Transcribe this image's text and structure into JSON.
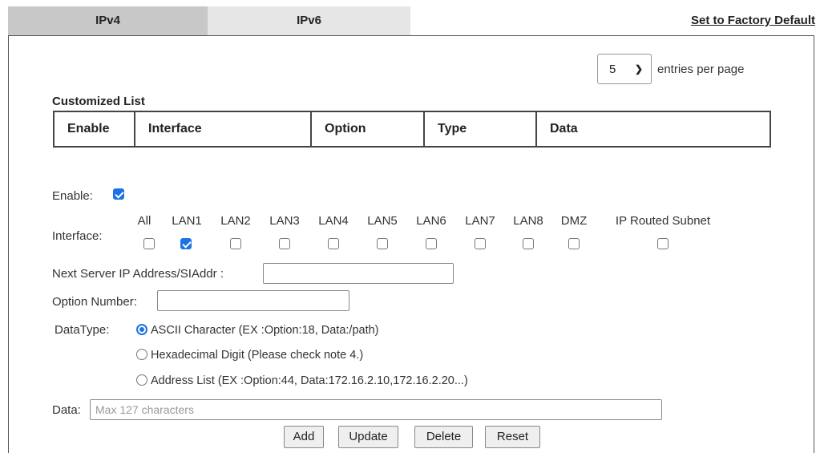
{
  "tabs": [
    {
      "label": "IPv4"
    },
    {
      "label": "IPv6"
    }
  ],
  "factory_default_link": "Set to Factory Default",
  "pagination": {
    "selected": "5",
    "label": "entries per page"
  },
  "customized_list": {
    "title": "Customized List",
    "columns": [
      "Enable",
      "Interface",
      "Option",
      "Type",
      "Data"
    ]
  },
  "form": {
    "enable": {
      "label": "Enable:",
      "checked": true
    },
    "interface": {
      "label": "Interface:",
      "options": [
        {
          "label": "All",
          "checked": false
        },
        {
          "label": "LAN1",
          "checked": true
        },
        {
          "label": "LAN2",
          "checked": false
        },
        {
          "label": "LAN3",
          "checked": false
        },
        {
          "label": "LAN4",
          "checked": false
        },
        {
          "label": "LAN5",
          "checked": false
        },
        {
          "label": "LAN6",
          "checked": false
        },
        {
          "label": "LAN7",
          "checked": false
        },
        {
          "label": "LAN8",
          "checked": false
        },
        {
          "label": "DMZ",
          "checked": false
        },
        {
          "label": "IP Routed Subnet",
          "checked": false
        }
      ]
    },
    "next_server": {
      "label": "Next Server IP Address/SIAddr :",
      "value": ""
    },
    "option_number": {
      "label": "Option Number:",
      "value": ""
    },
    "datatype": {
      "label": "DataType:",
      "options": [
        {
          "label": "ASCII Character (EX :Option:18, Data:/path)",
          "checked": true
        },
        {
          "label": "Hexadecimal Digit (Please check note 4.)",
          "checked": false
        },
        {
          "label": "Address List (EX :Option:44, Data:172.16.2.10,172.16.2.20...)",
          "checked": false
        }
      ]
    },
    "data": {
      "label": "Data:",
      "placeholder": "Max 127 characters",
      "value": ""
    }
  },
  "buttons": {
    "add": "Add",
    "update": "Update",
    "delete": "Delete",
    "reset": "Reset"
  }
}
